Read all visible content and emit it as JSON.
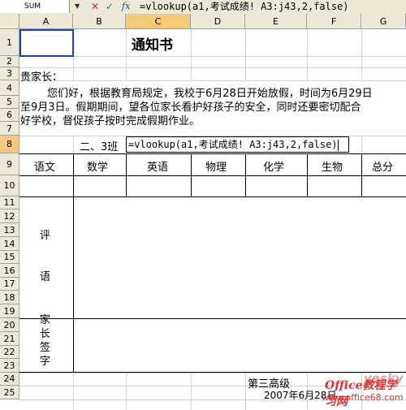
{
  "formula_bar": {
    "name_box": "SUM",
    "formula": "=vlookup(a1,考试成绩! A3:j43,2,false)"
  },
  "columns": [
    "A",
    "B",
    "C",
    "D",
    "E",
    "F",
    "G"
  ],
  "active_column": "C",
  "rows": [
    "1",
    "2",
    "3",
    "4",
    "5",
    "6",
    "7",
    "8",
    "9",
    "10",
    "11",
    "12",
    "13",
    "14",
    "15",
    "16",
    "17",
    "18",
    "19",
    "20",
    "21",
    "22",
    "23",
    "24",
    "25"
  ],
  "active_row": "8",
  "sheet": {
    "title": "通知书",
    "greeting": "贵家长：",
    "body_line1": "您们好，根据教育局规定，我校于6月28日开始放假，时间为6月29日",
    "body_line2": "至9月3日。假期期间，望各位家长看护好孩子的安全，同时还要密切配合",
    "body_line3": "好学校，督促孩子按时完成假期作业。",
    "class_label": "二、3班",
    "cell_edit_text": "=vlookup(a1,考试成绩! A3:j43,2,false)",
    "subjects": [
      "语文",
      "数学",
      "英语",
      "物理",
      "化学",
      "生物",
      "总分"
    ],
    "comment_label_1": "评",
    "comment_label_2": "语",
    "parent_sign": [
      "家",
      "长",
      "签",
      "字"
    ],
    "footer_org": "第三高级",
    "footer_date": "2007年6月28日"
  },
  "watermark": {
    "site": "Office教程学习网",
    "url": "www.office68.com",
    "brand": "yesky"
  }
}
